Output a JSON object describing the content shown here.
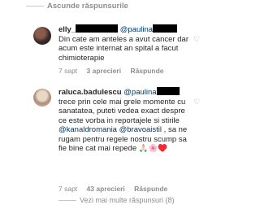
{
  "top": {
    "hide_replies": "Ascunde răspunsurile"
  },
  "comments": [
    {
      "username": "elly_",
      "mention": "@paulina",
      "text_after_mention": " Din cate am anteles a avut cancer dar acum este internat an spital a facut chimioterapie",
      "time": "7 sapt",
      "likes": "3 aprecieri",
      "reply": "Răspunde"
    },
    {
      "username": "raluca.badulescu",
      "mention": "@paulina",
      "text_part1": " trece prin cele mai grele momente cu sanatatea, puteti vedea exact despre ce este vorba in reportajele si stirile ",
      "mention2": "@kanaldromania",
      "text_part2": " ",
      "mention3": "@bravoaistil",
      "text_part3": " , sa ne rugam pentru regele nostru scump sa fie bine cat mai repede 🙏🏻🌸♥️",
      "time": "7 sapt",
      "likes": "43 aprecieri",
      "reply": "Răspunde"
    }
  ],
  "bottom": {
    "view_more": "Vezi mai multe răspunsuri (8)"
  },
  "icons": [
    "avatar",
    "heart-icon"
  ]
}
